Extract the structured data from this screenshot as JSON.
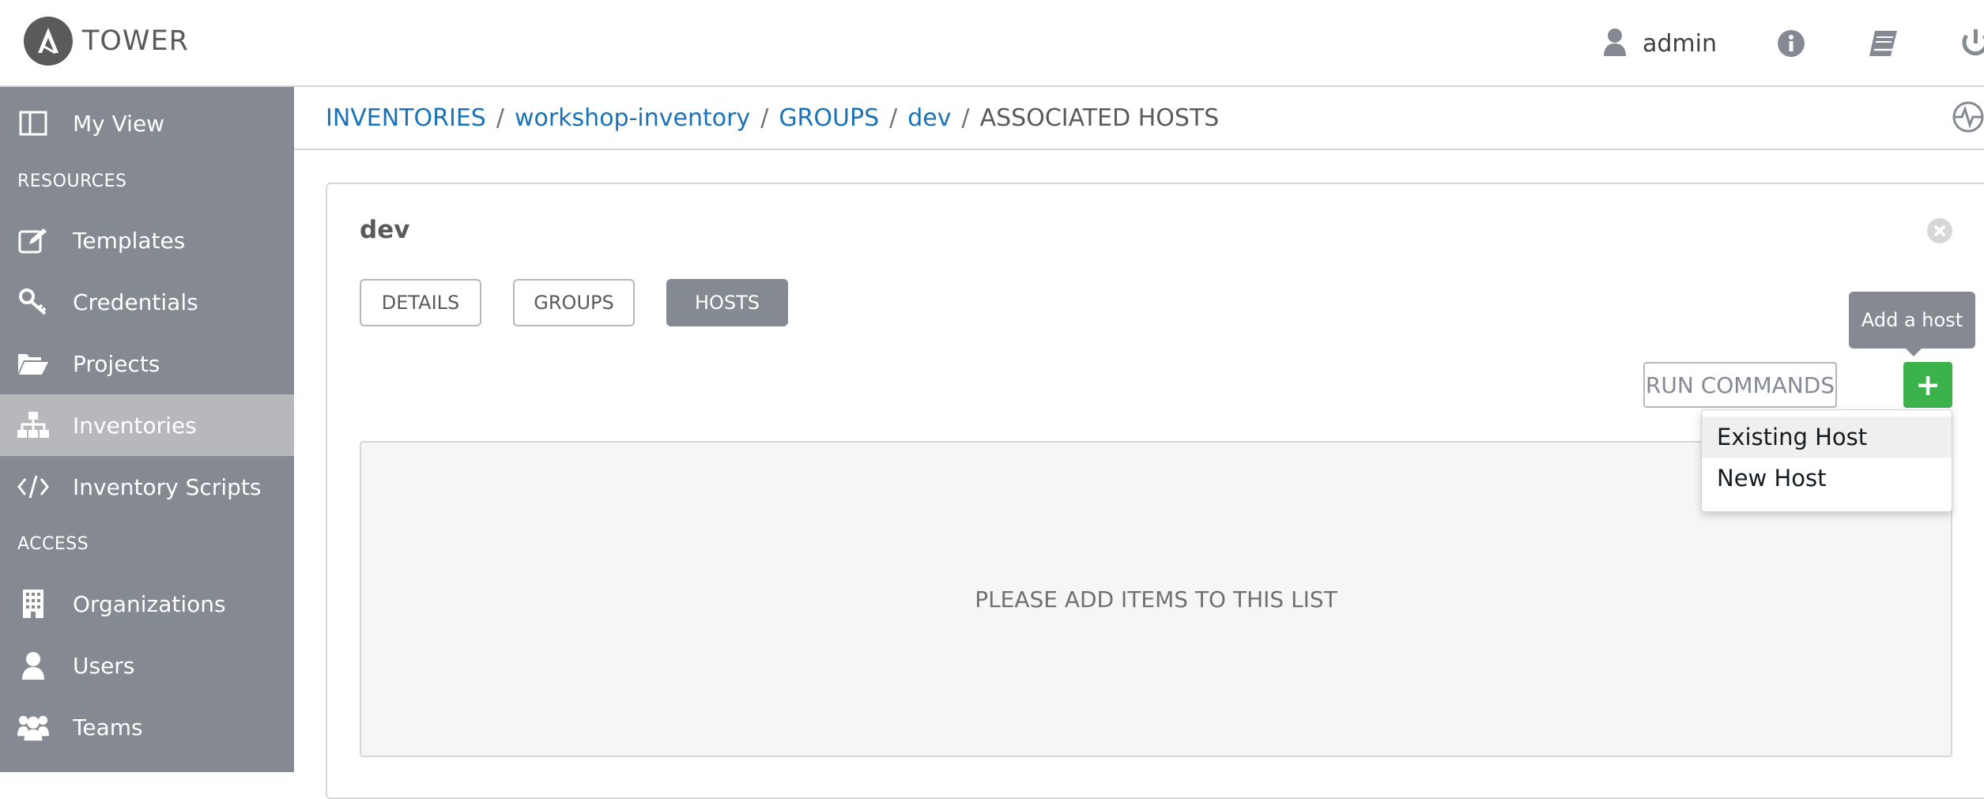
{
  "app": {
    "name": "TOWER",
    "accent_color": "#3cb34a",
    "link_color": "#1a72b8",
    "sidebar_color": "#848992"
  },
  "topnav": {
    "user": "admin",
    "icons": [
      "user-icon",
      "info-icon",
      "docs-book-icon",
      "logout-power-icon"
    ]
  },
  "sidebar": {
    "items": [
      {
        "label": "My View",
        "icon": "columns-icon"
      },
      {
        "label": "Templates",
        "icon": "edit-icon"
      },
      {
        "label": "Credentials",
        "icon": "key-icon"
      },
      {
        "label": "Projects",
        "icon": "folder-open-icon"
      },
      {
        "label": "Inventories",
        "icon": "sitemap-icon",
        "active": true
      },
      {
        "label": "Inventory Scripts",
        "icon": "code-icon"
      },
      {
        "label": "Organizations",
        "icon": "building-icon"
      },
      {
        "label": "Users",
        "icon": "user-icon"
      },
      {
        "label": "Teams",
        "icon": "users-icon"
      }
    ],
    "sections": {
      "resources": "RESOURCES",
      "access": "ACCESS"
    }
  },
  "breadcrumb": {
    "items": [
      "INVENTORIES",
      "workshop-inventory",
      "GROUPS",
      "dev"
    ],
    "separator": "/",
    "current": "ASSOCIATED HOSTS"
  },
  "panel": {
    "title": "dev",
    "tabs": [
      "DETAILS",
      "GROUPS",
      "HOSTS"
    ],
    "selected_tab": "HOSTS",
    "run_commands_label": "RUN COMMANDS",
    "add_label": "+",
    "add_tooltip": "Add a host",
    "add_menu": [
      "Existing Host",
      "New Host"
    ],
    "empty_message": "PLEASE ADD ITEMS TO THIS LIST"
  }
}
